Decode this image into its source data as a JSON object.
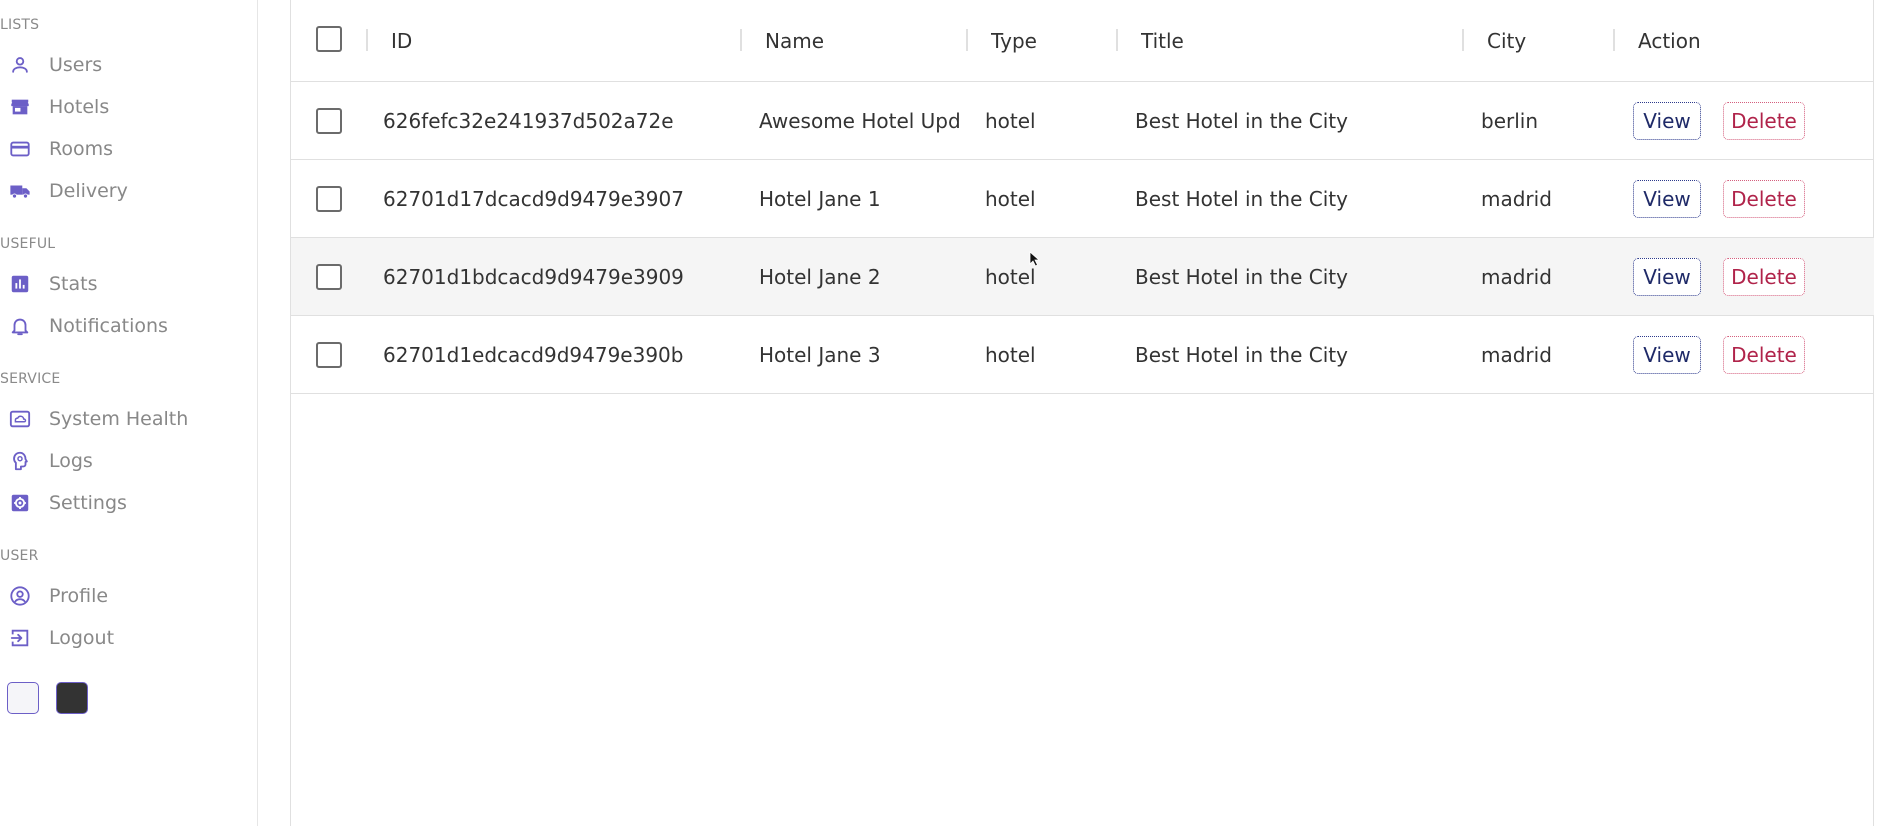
{
  "sidebar": {
    "sections": [
      {
        "title": "LISTS",
        "items": [
          {
            "label": "Users",
            "icon": "person-outline-icon"
          },
          {
            "label": "Hotels",
            "icon": "store-icon"
          },
          {
            "label": "Rooms",
            "icon": "credit-card-icon"
          },
          {
            "label": "Delivery",
            "icon": "truck-icon"
          }
        ]
      },
      {
        "title": "USEFUL",
        "items": [
          {
            "label": "Stats",
            "icon": "bar-chart-icon"
          },
          {
            "label": "Notifications",
            "icon": "bell-icon"
          }
        ]
      },
      {
        "title": "SERVICE",
        "items": [
          {
            "label": "System Health",
            "icon": "cloud-monitor-icon"
          },
          {
            "label": "Logs",
            "icon": "brain-icon"
          },
          {
            "label": "Settings",
            "icon": "settings-gear-icon"
          }
        ]
      },
      {
        "title": "USER",
        "items": [
          {
            "label": "Profile",
            "icon": "account-circle-icon"
          },
          {
            "label": "Logout",
            "icon": "exit-to-app-icon"
          }
        ]
      }
    ],
    "theme_swatches": [
      "light",
      "dark"
    ]
  },
  "table": {
    "columns": [
      "ID",
      "Name",
      "Type",
      "Title",
      "City",
      "Action"
    ],
    "rows": [
      {
        "id": "626fefc32e241937d502a72e",
        "name": "Awesome Hotel Upda",
        "type": "hotel",
        "title": "Best Hotel in the City",
        "city": "berlin",
        "view": "View",
        "delete": "Delete"
      },
      {
        "id": "62701d17dcacd9d9479e3907",
        "name": "Hotel Jane 1",
        "type": "hotel",
        "title": "Best Hotel in the City",
        "city": "madrid",
        "view": "View",
        "delete": "Delete"
      },
      {
        "id": "62701d1bdcacd9d9479e3909",
        "name": "Hotel Jane 2",
        "type": "hotel",
        "title": "Best Hotel in the City",
        "city": "madrid",
        "view": "View",
        "delete": "Delete"
      },
      {
        "id": "62701d1edcacd9d9479e390b",
        "name": "Hotel Jane 3",
        "type": "hotel",
        "title": "Best Hotel in the City",
        "city": "madrid",
        "view": "View",
        "delete": "Delete"
      }
    ]
  },
  "colors": {
    "accent": "#6c5fc7",
    "view_button": "#1f2a68",
    "delete_button": "#b0234a",
    "row_highlight": "#f5f5f5"
  }
}
